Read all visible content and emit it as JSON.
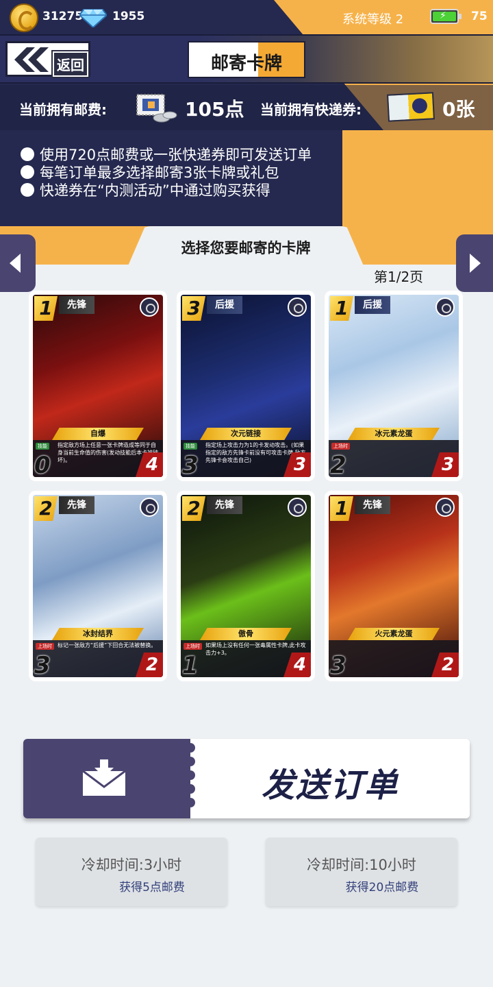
{
  "status_bar": {
    "coins": "31275",
    "gems": "1955",
    "system_level": "系统等级 2",
    "battery": "75"
  },
  "header": {
    "back_label": "返回",
    "title": "邮寄卡牌"
  },
  "balance": {
    "postage_label": "当前拥有邮费:",
    "postage_value": "105点",
    "express_label": "当前拥有快递券:",
    "express_value": "0张"
  },
  "notes": [
    "使用720点邮费或一张快递券即可发送订单",
    "每笔订单最多选择邮寄3张卡牌或礼包",
    "快递券在“内测活动”中通过购买获得"
  ],
  "section_title": "选择您要邮寄的卡牌",
  "page_indicator": "第1/2页",
  "cards": [
    {
      "cost": "1",
      "role": "先锋",
      "name": "自爆",
      "tag": "技能",
      "desc": "指定敌方场上任意一张卡牌造成等同于自身当前生命值的伤害(发动技能后本卡被破坏)。",
      "atk": "0",
      "hp": "4",
      "art": "fire"
    },
    {
      "cost": "3",
      "role": "后援",
      "name": "次元链接",
      "tag": "技能",
      "desc": "指定场上攻击力为1的卡发动攻击。(如果指定的敌方先锋卡前没有可攻击卡牌,敌方先锋卡会攻击自己)",
      "atk": "3",
      "hp": "3",
      "art": "void"
    },
    {
      "cost": "1",
      "role": "后援",
      "name": "冰元素龙蛋",
      "tag": "上场时",
      "desc": "",
      "atk": "2",
      "hp": "3",
      "art": "ice"
    },
    {
      "cost": "2",
      "role": "先锋",
      "name": "冰封结界",
      "tag": "上场时",
      "desc": "标记一张敌方“后援”下回合无法被替换。",
      "atk": "3",
      "hp": "2",
      "art": "frost"
    },
    {
      "cost": "2",
      "role": "先锋",
      "name": "傲骨",
      "tag": "上场时",
      "desc": "如果场上没有任何一张毒属性卡牌,此卡攻击力+3。",
      "atk": "1",
      "hp": "4",
      "art": "poison"
    },
    {
      "cost": "1",
      "role": "先锋",
      "name": "火元素龙蛋",
      "tag": "",
      "desc": "",
      "atk": "3",
      "hp": "2",
      "art": "egg"
    }
  ],
  "send_button": {
    "label": "发送订单"
  },
  "cooldowns": [
    {
      "time": "冷却时间:3小时",
      "reward": "获得5点邮费"
    },
    {
      "time": "冷却时间:10小时",
      "reward": "获得20点邮费"
    }
  ],
  "colors": {
    "navy": "#25294f",
    "gold": "#f6b24a",
    "button_purple": "#4a4470",
    "send_text": "#1d2147"
  }
}
